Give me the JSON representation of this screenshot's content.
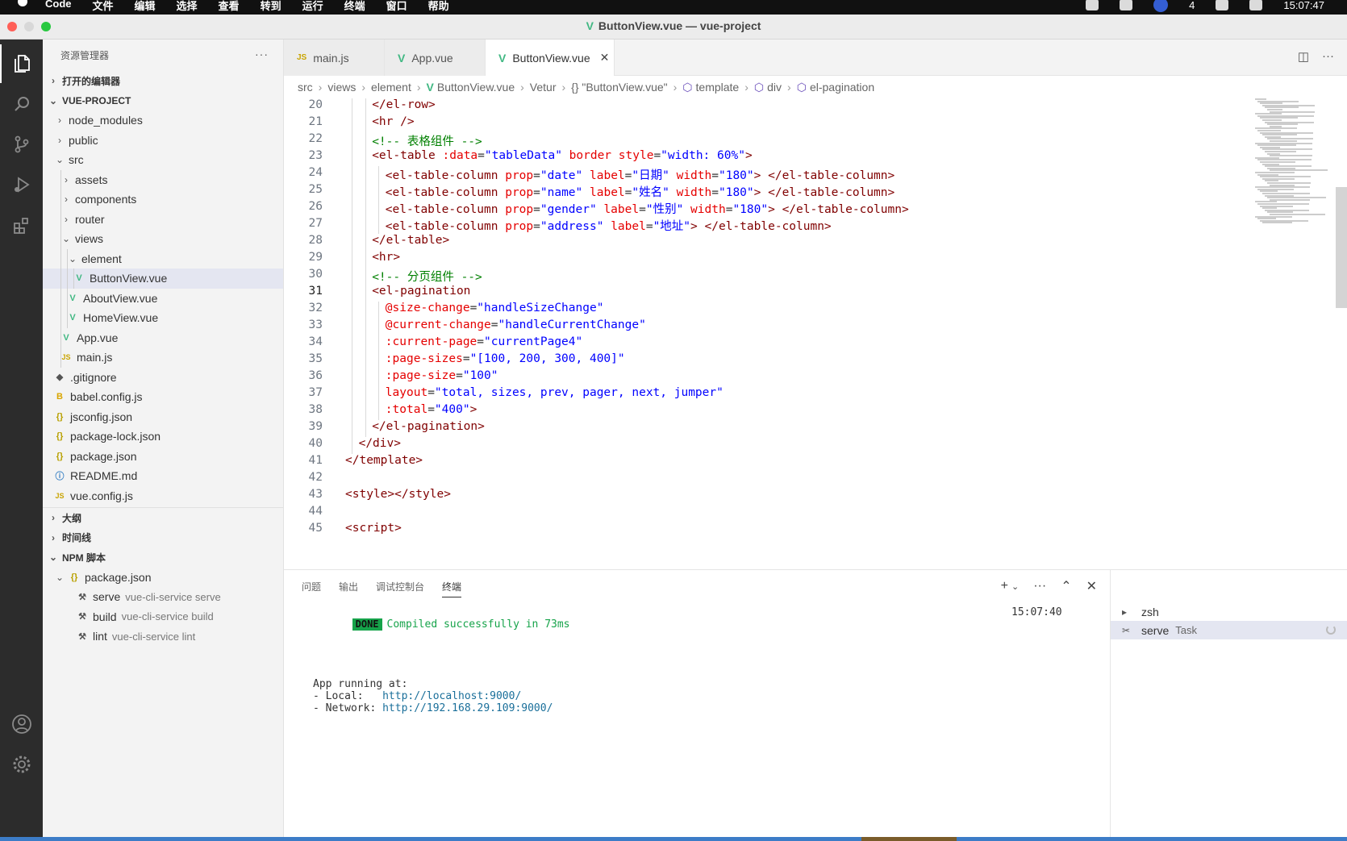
{
  "menubar": {
    "app": "Code",
    "items": [
      "文件",
      "编辑",
      "选择",
      "查看",
      "转到",
      "运行",
      "终端",
      "窗口",
      "帮助"
    ],
    "clock": "15:07:47",
    "notif_count": "4"
  },
  "window": {
    "title": "ButtonView.vue — vue-project"
  },
  "sidebar": {
    "title": "资源管理器",
    "open_editors": "打开的编辑器",
    "project": "VUE-PROJECT",
    "tree": [
      {
        "label": "node_modules",
        "type": "folder",
        "depth": 1,
        "open": false
      },
      {
        "label": "public",
        "type": "folder",
        "depth": 1,
        "open": false
      },
      {
        "label": "src",
        "type": "folder",
        "depth": 1,
        "open": true
      },
      {
        "label": "assets",
        "type": "folder",
        "depth": 2,
        "open": false
      },
      {
        "label": "components",
        "type": "folder",
        "depth": 2,
        "open": false
      },
      {
        "label": "router",
        "type": "folder",
        "depth": 2,
        "open": false
      },
      {
        "label": "views",
        "type": "folder",
        "depth": 2,
        "open": true
      },
      {
        "label": "element",
        "type": "folder",
        "depth": 3,
        "open": true
      },
      {
        "label": "ButtonView.vue",
        "type": "vue",
        "depth": 4,
        "selected": true
      },
      {
        "label": "AboutView.vue",
        "type": "vue",
        "depth": 3
      },
      {
        "label": "HomeView.vue",
        "type": "vue",
        "depth": 3
      },
      {
        "label": "App.vue",
        "type": "vue",
        "depth": 2
      },
      {
        "label": "main.js",
        "type": "js",
        "depth": 2
      },
      {
        "label": ".gitignore",
        "type": "git",
        "depth": 1
      },
      {
        "label": "babel.config.js",
        "type": "babel",
        "depth": 1
      },
      {
        "label": "jsconfig.json",
        "type": "json",
        "depth": 1
      },
      {
        "label": "package-lock.json",
        "type": "json",
        "depth": 1
      },
      {
        "label": "package.json",
        "type": "json",
        "depth": 1
      },
      {
        "label": "README.md",
        "type": "info",
        "depth": 1
      },
      {
        "label": "vue.config.js",
        "type": "js",
        "depth": 1
      }
    ],
    "outline": "大纲",
    "timeline": "时间线",
    "npm_scripts": "NPM 脚本",
    "npm_package": "package.json",
    "npm_items": [
      {
        "name": "serve",
        "cmd": "vue-cli-service serve"
      },
      {
        "name": "build",
        "cmd": "vue-cli-service build"
      },
      {
        "name": "lint",
        "cmd": "vue-cli-service lint"
      }
    ]
  },
  "tabs": [
    {
      "label": "main.js",
      "icon": "js"
    },
    {
      "label": "App.vue",
      "icon": "vue"
    },
    {
      "label": "ButtonView.vue",
      "icon": "vue",
      "active": true
    }
  ],
  "breadcrumb": [
    "src",
    "views",
    "element",
    "ButtonView.vue",
    "Vetur",
    "{} \"ButtonView.vue\"",
    "template",
    "div",
    "el-pagination"
  ],
  "code": {
    "current_line": 31,
    "lines": [
      {
        "n": 20,
        "indent": 2,
        "tokens": [
          [
            "tag",
            "</el-row>"
          ]
        ]
      },
      {
        "n": 21,
        "indent": 2,
        "tokens": [
          [
            "tag",
            "<hr />"
          ]
        ]
      },
      {
        "n": 22,
        "indent": 2,
        "tokens": [
          [
            "cmt",
            "<!-- 表格组件 -->"
          ]
        ]
      },
      {
        "n": 23,
        "indent": 2,
        "tokens": [
          [
            "tag",
            "<el-table"
          ],
          [
            "txt",
            " "
          ],
          [
            "attr",
            ":data"
          ],
          [
            "txt",
            "="
          ],
          [
            "str",
            "\"tableData\""
          ],
          [
            "txt",
            " "
          ],
          [
            "attr",
            "border"
          ],
          [
            "txt",
            " "
          ],
          [
            "attr",
            "style"
          ],
          [
            "txt",
            "="
          ],
          [
            "str",
            "\"width: 60%\""
          ],
          [
            "tag",
            ">"
          ]
        ]
      },
      {
        "n": 24,
        "indent": 3,
        "tokens": [
          [
            "tag",
            "<el-table-column"
          ],
          [
            "txt",
            " "
          ],
          [
            "attr",
            "prop"
          ],
          [
            "txt",
            "="
          ],
          [
            "str",
            "\"date\""
          ],
          [
            "txt",
            " "
          ],
          [
            "attr",
            "label"
          ],
          [
            "txt",
            "="
          ],
          [
            "str",
            "\"日期\""
          ],
          [
            "txt",
            " "
          ],
          [
            "attr",
            "width"
          ],
          [
            "txt",
            "="
          ],
          [
            "str",
            "\"180\""
          ],
          [
            "tag",
            ">"
          ],
          [
            "txt",
            " "
          ],
          [
            "tag",
            "</el-table-column>"
          ]
        ]
      },
      {
        "n": 25,
        "indent": 3,
        "tokens": [
          [
            "tag",
            "<el-table-column"
          ],
          [
            "txt",
            " "
          ],
          [
            "attr",
            "prop"
          ],
          [
            "txt",
            "="
          ],
          [
            "str",
            "\"name\""
          ],
          [
            "txt",
            " "
          ],
          [
            "attr",
            "label"
          ],
          [
            "txt",
            "="
          ],
          [
            "str",
            "\"姓名\""
          ],
          [
            "txt",
            " "
          ],
          [
            "attr",
            "width"
          ],
          [
            "txt",
            "="
          ],
          [
            "str",
            "\"180\""
          ],
          [
            "tag",
            ">"
          ],
          [
            "txt",
            " "
          ],
          [
            "tag",
            "</el-table-column>"
          ]
        ]
      },
      {
        "n": 26,
        "indent": 3,
        "tokens": [
          [
            "tag",
            "<el-table-column"
          ],
          [
            "txt",
            " "
          ],
          [
            "attr",
            "prop"
          ],
          [
            "txt",
            "="
          ],
          [
            "str",
            "\"gender\""
          ],
          [
            "txt",
            " "
          ],
          [
            "attr",
            "label"
          ],
          [
            "txt",
            "="
          ],
          [
            "str",
            "\"性别\""
          ],
          [
            "txt",
            " "
          ],
          [
            "attr",
            "width"
          ],
          [
            "txt",
            "="
          ],
          [
            "str",
            "\"180\""
          ],
          [
            "tag",
            ">"
          ],
          [
            "txt",
            " "
          ],
          [
            "tag",
            "</el-table-column>"
          ]
        ]
      },
      {
        "n": 27,
        "indent": 3,
        "tokens": [
          [
            "tag",
            "<el-table-column"
          ],
          [
            "txt",
            " "
          ],
          [
            "attr",
            "prop"
          ],
          [
            "txt",
            "="
          ],
          [
            "str",
            "\"address\""
          ],
          [
            "txt",
            " "
          ],
          [
            "attr",
            "label"
          ],
          [
            "txt",
            "="
          ],
          [
            "str",
            "\"地址\""
          ],
          [
            "tag",
            ">"
          ],
          [
            "txt",
            " "
          ],
          [
            "tag",
            "</el-table-column>"
          ]
        ]
      },
      {
        "n": 28,
        "indent": 2,
        "tokens": [
          [
            "tag",
            "</el-table>"
          ]
        ]
      },
      {
        "n": 29,
        "indent": 2,
        "tokens": [
          [
            "tag",
            "<hr>"
          ]
        ]
      },
      {
        "n": 30,
        "indent": 2,
        "tokens": [
          [
            "cmt",
            "<!-- 分页组件 -->"
          ]
        ]
      },
      {
        "n": 31,
        "indent": 2,
        "tokens": [
          [
            "tag",
            "<el-pagination"
          ]
        ]
      },
      {
        "n": 32,
        "indent": 3,
        "tokens": [
          [
            "attr",
            "@size-change"
          ],
          [
            "txt",
            "="
          ],
          [
            "str",
            "\"handleSizeChange\""
          ]
        ]
      },
      {
        "n": 33,
        "indent": 3,
        "tokens": [
          [
            "attr",
            "@current-change"
          ],
          [
            "txt",
            "="
          ],
          [
            "str",
            "\"handleCurrentChange\""
          ]
        ]
      },
      {
        "n": 34,
        "indent": 3,
        "tokens": [
          [
            "attr",
            ":current-page"
          ],
          [
            "txt",
            "="
          ],
          [
            "str",
            "\"currentPage4\""
          ]
        ]
      },
      {
        "n": 35,
        "indent": 3,
        "tokens": [
          [
            "attr",
            ":page-sizes"
          ],
          [
            "txt",
            "="
          ],
          [
            "str",
            "\"[100, 200, 300, 400]\""
          ]
        ]
      },
      {
        "n": 36,
        "indent": 3,
        "tokens": [
          [
            "attr",
            ":page-size"
          ],
          [
            "txt",
            "="
          ],
          [
            "str",
            "\"100\""
          ]
        ]
      },
      {
        "n": 37,
        "indent": 3,
        "tokens": [
          [
            "attr",
            "layout"
          ],
          [
            "txt",
            "="
          ],
          [
            "str",
            "\"total, sizes, prev, pager, next, jumper\""
          ]
        ]
      },
      {
        "n": 38,
        "indent": 3,
        "tokens": [
          [
            "attr",
            ":total"
          ],
          [
            "txt",
            "="
          ],
          [
            "str",
            "\"400\""
          ],
          [
            "tag",
            ">"
          ]
        ]
      },
      {
        "n": 39,
        "indent": 2,
        "tokens": [
          [
            "tag",
            "</el-pagination>"
          ]
        ]
      },
      {
        "n": 40,
        "indent": 1,
        "tokens": [
          [
            "tag",
            "</div>"
          ]
        ]
      },
      {
        "n": 41,
        "indent": 0,
        "tokens": [
          [
            "tag",
            "</template>"
          ]
        ]
      },
      {
        "n": 42,
        "indent": 0,
        "tokens": []
      },
      {
        "n": 43,
        "indent": 0,
        "tokens": [
          [
            "tag",
            "<style></style>"
          ]
        ]
      },
      {
        "n": 44,
        "indent": 0,
        "tokens": []
      },
      {
        "n": 45,
        "indent": 0,
        "tokens": [
          [
            "tag",
            "<script>"
          ]
        ]
      }
    ]
  },
  "panel": {
    "tabs": [
      "问题",
      "输出",
      "调试控制台",
      "终端"
    ],
    "active_tab": "终端",
    "done_badge": "DONE",
    "compiled": "Compiled successfully in 73ms",
    "time": "15:07:40",
    "running": "App running at:",
    "local_label": "- Local:   ",
    "local_url": "http://localhost:9000/",
    "network_label": "- Network: ",
    "network_url": "http://192.168.29.109:9000/",
    "terminals": [
      {
        "name": "zsh",
        "sub": ""
      },
      {
        "name": "serve",
        "sub": "Task",
        "selected": true
      }
    ]
  },
  "colors": {
    "vue_green": "#41b883",
    "tag": "#800000",
    "attr": "#e50000",
    "string": "#0000ff",
    "comment": "#008000",
    "statusbar": "#3c7cc7"
  }
}
